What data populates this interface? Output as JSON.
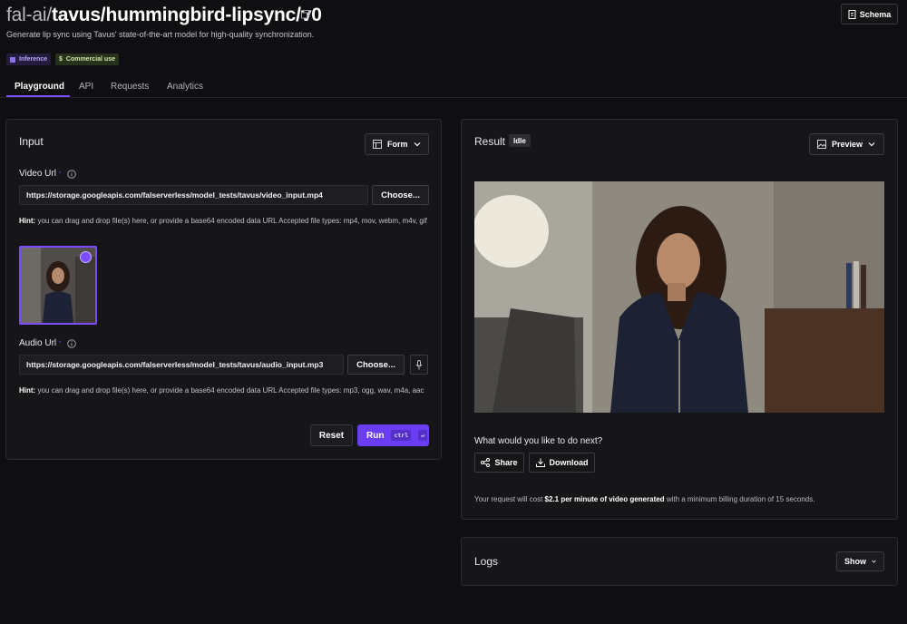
{
  "header": {
    "namespace": "fal-ai/",
    "model": "tavus/hummingbird-lipsync/v0",
    "description": "Generate lip sync using Tavus' state-of-the-art model for high-quality synchronization.",
    "schema_label": "Schema",
    "badges": [
      {
        "label": "Inference",
        "icon": "list-icon"
      },
      {
        "label": "Commercial use",
        "icon": "dollar-icon"
      }
    ]
  },
  "tabs": [
    {
      "label": "Playground",
      "active": true
    },
    {
      "label": "API",
      "active": false
    },
    {
      "label": "Requests",
      "active": false
    },
    {
      "label": "Analytics",
      "active": false
    }
  ],
  "input": {
    "title": "Input",
    "mode_label": "Form",
    "video": {
      "label": "Video Url",
      "required_marker": "*",
      "value": "https://storage.googleapis.com/falserverless/model_tests/tavus/video_input.mp4",
      "choose_label": "Choose...",
      "hint_prefix": "Hint:",
      "hint": "you can drag and drop file(s) here, or provide a base64 encoded data URL Accepted file types: mp4, mov, webm, m4v, gif"
    },
    "audio": {
      "label": "Audio Url",
      "required_marker": "*",
      "value": "https://storage.googleapis.com/falserverless/model_tests/tavus/audio_input.mp3",
      "choose_label": "Choose...",
      "hint_prefix": "Hint:",
      "hint": "you can drag and drop file(s) here, or provide a base64 encoded data URL Accepted file types: mp3, ogg, wav, m4a, aac"
    },
    "reset_label": "Reset",
    "run_label": "Run",
    "run_shortcut": "ctrl",
    "run_shortcut_key": "↵"
  },
  "result": {
    "title": "Result",
    "status": "Idle",
    "mode_label": "Preview",
    "next_prompt": "What would you like to do next?",
    "share_label": "Share",
    "download_label": "Download",
    "cost_prefix": "Your request will cost",
    "cost_value": "$2.1 per minute of video generated",
    "cost_suffix": "with a minimum billing duration of 15 seconds."
  },
  "logs": {
    "title": "Logs",
    "toggle_label": "Show"
  },
  "colors": {
    "accent": "#7c4dff",
    "run_button": "#6b3df2",
    "background": "#0f0f11",
    "panel": "#161619"
  }
}
